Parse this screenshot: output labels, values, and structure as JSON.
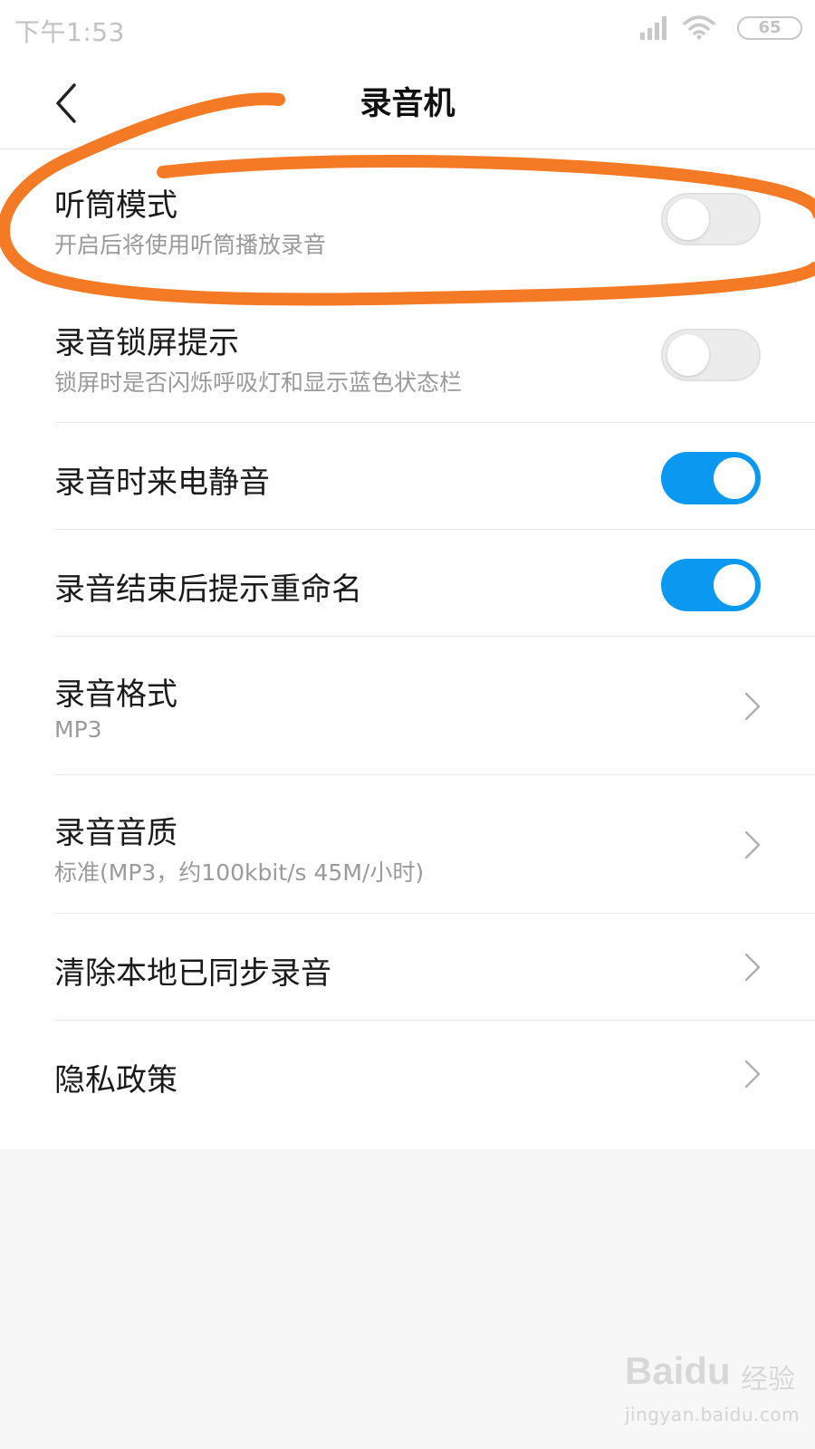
{
  "status_bar": {
    "time": "下午1:53",
    "battery": "65"
  },
  "header": {
    "title": "录音机"
  },
  "settings": [
    {
      "title": "听筒模式",
      "subtitle": "开启后将使用听筒播放录音",
      "control": "toggle",
      "enabled": false
    },
    {
      "title": "录音锁屏提示",
      "subtitle": "锁屏时是否闪烁呼吸灯和显示蓝色状态栏",
      "control": "toggle",
      "enabled": false
    },
    {
      "title": "录音时来电静音",
      "control": "toggle",
      "enabled": true
    },
    {
      "title": "录音结束后提示重命名",
      "control": "toggle",
      "enabled": true
    },
    {
      "title": "录音格式",
      "subtitle": "MP3",
      "control": "chevron"
    },
    {
      "title": "录音音质",
      "subtitle": "标准(MP3，约100kbit/s 45M/小时)",
      "control": "chevron"
    },
    {
      "title": "清除本地已同步录音",
      "control": "chevron"
    },
    {
      "title": "隐私政策",
      "control": "chevron"
    }
  ],
  "colors": {
    "toggle_on": "#0a98f0",
    "toggle_off": "#ececec",
    "annotation": "#f47a26"
  },
  "watermark": {
    "brand": "Baidu",
    "product": "经验",
    "url": "jingyan.baidu.com"
  }
}
